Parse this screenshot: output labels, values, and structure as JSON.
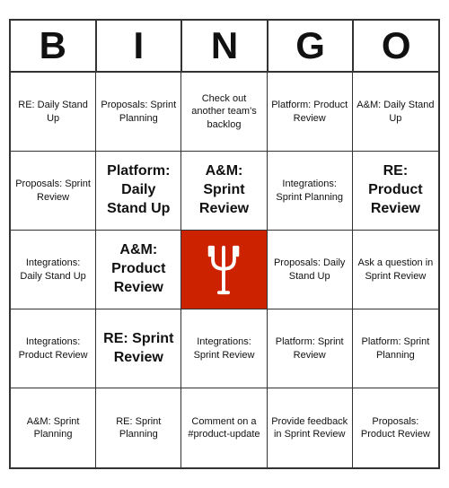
{
  "header": {
    "letters": [
      "B",
      "I",
      "N",
      "G",
      "O"
    ]
  },
  "cells": [
    {
      "text": "RE: Daily Stand Up",
      "large": false,
      "free": false
    },
    {
      "text": "Proposals: Sprint Planning",
      "large": false,
      "free": false
    },
    {
      "text": "Check out another team's backlog",
      "large": false,
      "free": false
    },
    {
      "text": "Platform: Product Review",
      "large": false,
      "free": false
    },
    {
      "text": "A&M: Daily Stand Up",
      "large": false,
      "free": false
    },
    {
      "text": "Proposals: Sprint Review",
      "large": false,
      "free": false
    },
    {
      "text": "Platform: Daily Stand Up",
      "large": true,
      "free": false
    },
    {
      "text": "A&M: Sprint Review",
      "large": true,
      "free": false
    },
    {
      "text": "Integrations: Sprint Planning",
      "large": false,
      "free": false
    },
    {
      "text": "RE: Product Review",
      "large": true,
      "free": false
    },
    {
      "text": "Integrations: Daily Stand Up",
      "large": false,
      "free": false
    },
    {
      "text": "A&M: Product Review",
      "large": true,
      "free": false
    },
    {
      "text": "",
      "large": false,
      "free": true
    },
    {
      "text": "Proposals: Daily Stand Up",
      "large": false,
      "free": false
    },
    {
      "text": "Ask a question in Sprint Review",
      "large": false,
      "free": false
    },
    {
      "text": "Integrations: Product Review",
      "large": false,
      "free": false
    },
    {
      "text": "RE: Sprint Review",
      "large": true,
      "free": false
    },
    {
      "text": "Integrations: Sprint Review",
      "large": false,
      "free": false
    },
    {
      "text": "Platform: Sprint Review",
      "large": false,
      "free": false
    },
    {
      "text": "Platform: Sprint Planning",
      "large": false,
      "free": false
    },
    {
      "text": "A&M: Sprint Planning",
      "large": false,
      "free": false
    },
    {
      "text": "RE: Sprint Planning",
      "large": false,
      "free": false
    },
    {
      "text": "Comment on a #product-update",
      "large": false,
      "free": false
    },
    {
      "text": "Provide feedback in Sprint Review",
      "large": false,
      "free": false
    },
    {
      "text": "Proposals: Product Review",
      "large": false,
      "free": false
    }
  ]
}
